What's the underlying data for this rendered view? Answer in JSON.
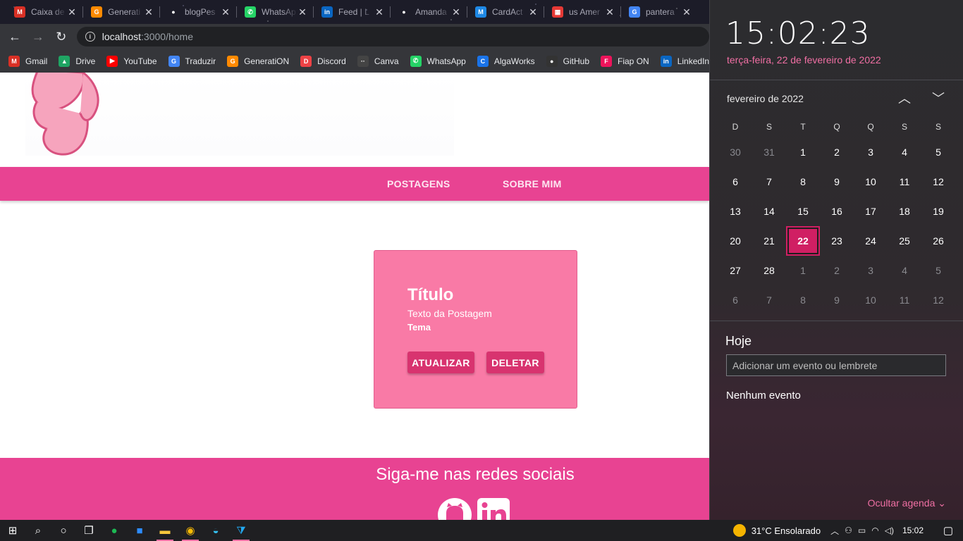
{
  "browser": {
    "tabs": [
      {
        "title": "Caixa de",
        "icon": "gmail-icon",
        "color": "#d93025",
        "glyph": "M"
      },
      {
        "title": "Generati",
        "icon": "generation-icon",
        "color": "#ff8a00",
        "glyph": "G"
      },
      {
        "title": "blogPes",
        "icon": "github-icon",
        "color": "#ffffff",
        "glyph": "●"
      },
      {
        "title": "WhatsAp",
        "icon": "whatsapp-icon",
        "color": "#25d366",
        "glyph": "✆"
      },
      {
        "title": "Feed | L",
        "icon": "linkedin-icon",
        "color": "#0a66c2",
        "glyph": "in"
      },
      {
        "title": "Amanda",
        "icon": "github-icon",
        "color": "#ffffff",
        "glyph": "●"
      },
      {
        "title": "CardAct",
        "icon": "material-icon",
        "color": "#1e88e5",
        "glyph": "M"
      },
      {
        "title": "us Amer",
        "icon": "tiles-icon",
        "color": "#e53935",
        "glyph": "▦"
      },
      {
        "title": "pantera",
        "icon": "google-icon",
        "color": "#4285f4",
        "glyph": "G"
      }
    ],
    "url_host": "localhost",
    "url_path": ":3000/home",
    "bookmarks": [
      {
        "label": "Gmail",
        "icon": "gmail-icon",
        "color": "#d93025",
        "glyph": "M"
      },
      {
        "label": "Drive",
        "icon": "drive-icon",
        "color": "#1fa463",
        "glyph": "▲"
      },
      {
        "label": "YouTube",
        "icon": "youtube-icon",
        "color": "#ff0000",
        "glyph": "▶"
      },
      {
        "label": "Traduzir",
        "icon": "translate-icon",
        "color": "#4285f4",
        "glyph": "G"
      },
      {
        "label": "Generati​ON",
        "icon": "generation-icon",
        "color": "#ff8a00",
        "glyph": "G"
      },
      {
        "label": "Discord",
        "icon": "discord-icon",
        "color": "#ed4245",
        "glyph": "D"
      },
      {
        "label": "Canva",
        "icon": "canva-icon",
        "color": "#444444",
        "glyph": "··"
      },
      {
        "label": "WhatsApp",
        "icon": "whatsapp-icon",
        "color": "#25d366",
        "glyph": "✆"
      },
      {
        "label": "AlgaWorks",
        "icon": "algaworks-icon",
        "color": "#1a73e8",
        "glyph": "C"
      },
      {
        "label": "GitHub",
        "icon": "github-icon",
        "color": "#333333",
        "glyph": "●"
      },
      {
        "label": "Fiap ON",
        "icon": "fiap-icon",
        "color": "#ed145b",
        "glyph": "F"
      },
      {
        "label": "LinkedIn",
        "icon": "linkedin-icon",
        "color": "#0a66c2",
        "glyph": "in"
      }
    ]
  },
  "page": {
    "nav": {
      "postagens": "POSTAGENS",
      "sobre": "SOBRE MIM"
    },
    "card": {
      "title": "Título",
      "text": "Texto da Postagem",
      "tema": "Tema",
      "update": "ATUALIZAR",
      "delete": "DELETAR"
    },
    "footer": {
      "follow": "Siga-me nas redes sociais"
    },
    "colors": {
      "brand_pink": "#e84392",
      "card_pink": "#f97aa6",
      "button_pink": "#d8336f"
    }
  },
  "flyout": {
    "time": "15:02:23",
    "date_long": "terça-feira, 22 de fevereiro de 2022",
    "month_title": "fevereiro de 2022",
    "weekdays": [
      "D",
      "S",
      "T",
      "Q",
      "Q",
      "S",
      "S"
    ],
    "weeks": [
      [
        {
          "d": "30",
          "dim": true
        },
        {
          "d": "31",
          "dim": true
        },
        {
          "d": "1"
        },
        {
          "d": "2"
        },
        {
          "d": "3"
        },
        {
          "d": "4"
        },
        {
          "d": "5"
        }
      ],
      [
        {
          "d": "6"
        },
        {
          "d": "7"
        },
        {
          "d": "8"
        },
        {
          "d": "9"
        },
        {
          "d": "10"
        },
        {
          "d": "11"
        },
        {
          "d": "12"
        }
      ],
      [
        {
          "d": "13"
        },
        {
          "d": "14"
        },
        {
          "d": "15"
        },
        {
          "d": "16"
        },
        {
          "d": "17"
        },
        {
          "d": "18"
        },
        {
          "d": "19"
        }
      ],
      [
        {
          "d": "20"
        },
        {
          "d": "21"
        },
        {
          "d": "22",
          "today": true
        },
        {
          "d": "23"
        },
        {
          "d": "24"
        },
        {
          "d": "25"
        },
        {
          "d": "26"
        }
      ],
      [
        {
          "d": "27"
        },
        {
          "d": "28"
        },
        {
          "d": "1",
          "dim": true
        },
        {
          "d": "2",
          "dim": true
        },
        {
          "d": "3",
          "dim": true
        },
        {
          "d": "4",
          "dim": true
        },
        {
          "d": "5",
          "dim": true
        }
      ],
      [
        {
          "d": "6",
          "dim": true
        },
        {
          "d": "7",
          "dim": true
        },
        {
          "d": "8",
          "dim": true
        },
        {
          "d": "9",
          "dim": true
        },
        {
          "d": "10",
          "dim": true
        },
        {
          "d": "11",
          "dim": true
        },
        {
          "d": "12",
          "dim": true
        }
      ]
    ],
    "today_heading": "Hoje",
    "event_placeholder": "Adicionar um evento ou lembrete",
    "no_events": "Nenhum evento",
    "hide_agenda": "Ocultar agenda",
    "accent": "#d01f63"
  },
  "taskbar": {
    "apps": [
      {
        "name": "start-icon",
        "glyph": "⊞"
      },
      {
        "name": "search-icon",
        "glyph": "⌕"
      },
      {
        "name": "cortana-icon",
        "glyph": "○"
      },
      {
        "name": "task-view-icon",
        "glyph": "❐"
      },
      {
        "name": "spotify-icon",
        "glyph": "●",
        "color": "#1db954"
      },
      {
        "name": "zoom-icon",
        "glyph": "■",
        "color": "#2d8cff"
      },
      {
        "name": "file-explorer-icon",
        "glyph": "▬",
        "color": "#f8c83c",
        "active": true
      },
      {
        "name": "chrome-icon",
        "glyph": "◉",
        "color": "#fbbc04",
        "active": true
      },
      {
        "name": "edge-icon",
        "glyph": "◒",
        "color": "#35c1f1"
      },
      {
        "name": "vscode-icon",
        "glyph": "⧩",
        "color": "#23a9f2",
        "active": true
      }
    ],
    "weather": "31°C  Ensolarado",
    "clock": "15:02"
  }
}
